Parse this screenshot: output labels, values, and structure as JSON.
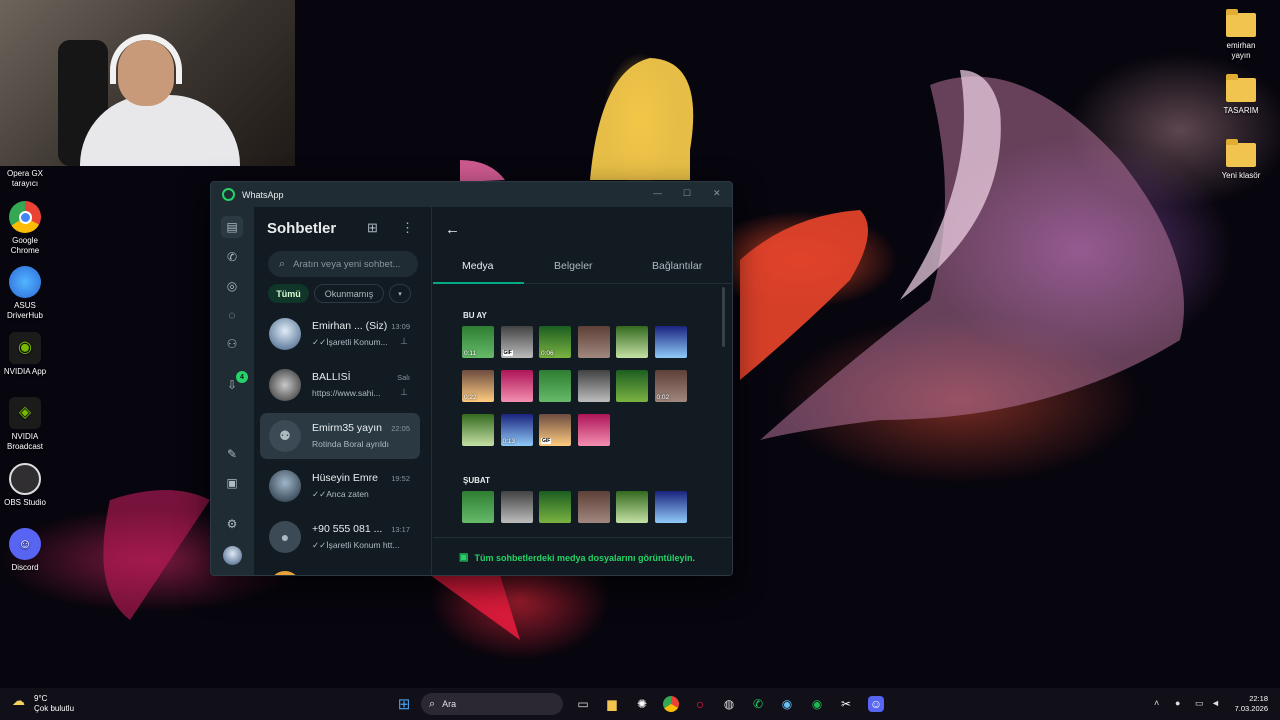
{
  "desktop": {
    "icons_left": [
      {
        "label": "Opera GX\ntarayıcı",
        "icon": "opera-gx-icon"
      },
      {
        "label": "Google\nChrome",
        "icon": "chrome-icon"
      },
      {
        "label": "ASUS\nDriverHub",
        "icon": "asus-driverhub-icon"
      },
      {
        "label": "NVIDIA App",
        "icon": "nvidia-app-icon"
      },
      {
        "label": "NVIDIA\nBroadcast",
        "icon": "nvidia-broadcast-icon"
      },
      {
        "label": "OBS Studio",
        "icon": "obs-icon"
      },
      {
        "label": "Discord",
        "icon": "discord-icon"
      }
    ],
    "icons_right": [
      {
        "label": "emirhan\nyayın",
        "icon": "folder-icon"
      },
      {
        "label": "TASARIM",
        "icon": "folder-icon"
      },
      {
        "label": "Yeni klasör",
        "icon": "folder-icon"
      }
    ]
  },
  "whatsapp": {
    "window_title": "WhatsApp",
    "rail": {
      "updates_badge": "4"
    },
    "list": {
      "title": "Sohbetler",
      "search_placeholder": "Aratın veya yeni sohbet...",
      "filters": [
        "Tümü",
        "Okunmamış"
      ],
      "chats": [
        {
          "name": "Emirhan ... (Siz)",
          "time": "13:09",
          "preview": "✓✓İşaretli Konum...",
          "pinned": true
        },
        {
          "name": "BALLISİ",
          "time": "Salı",
          "preview": "https://www.sahi...",
          "pinned": true
        },
        {
          "name": "Emirm35 yayın",
          "time": "22:05",
          "preview": "Rotinda Boral ayrıldı",
          "pinned": false
        },
        {
          "name": "Hüseyin Emre",
          "time": "19:52",
          "preview": "✓✓Anca zaten",
          "pinned": false
        },
        {
          "name": "+90 555 081 ...",
          "time": "13:17",
          "preview": "✓✓İşaretli Konum htt...",
          "pinned": false
        }
      ]
    },
    "panel": {
      "tabs": [
        "Medya",
        "Belgeler",
        "Bağlantılar"
      ],
      "active_tab": "Medya",
      "sections": [
        {
          "title": "BU AY",
          "rows": [
            [
              {
                "badge": "0:11"
              },
              {
                "badge": "GIF"
              },
              {
                "badge": "0:06"
              },
              {
                "badge": ""
              },
              {
                "badge": ""
              },
              {
                "badge": ""
              }
            ],
            [
              {
                "badge": "0:22"
              },
              {
                "badge": ""
              },
              {
                "badge": ""
              },
              {
                "badge": ""
              },
              {
                "badge": ""
              },
              {
                "badge": "0:02"
              }
            ],
            [
              {
                "badge": ""
              },
              {
                "badge": "0:13"
              },
              {
                "badge": "GIF"
              },
              {
                "badge": ""
              }
            ]
          ]
        },
        {
          "title": "ŞUBAT",
          "rows": [
            [
              {
                "badge": ""
              },
              {
                "badge": ""
              },
              {
                "badge": ""
              },
              {
                "badge": ""
              },
              {
                "badge": ""
              },
              {
                "badge": ""
              }
            ]
          ]
        }
      ],
      "footer_link": "Tüm sohbetlerdeki medya dosyalarını görüntüleyin."
    }
  },
  "taskbar": {
    "weather_temp": "9°C",
    "weather_desc": "Çok bulutlu",
    "search_placeholder": "Ara",
    "time": "22:18",
    "date": "7.03.2026"
  },
  "colors": {
    "accent": "#00a884",
    "accent_text": "#25d366",
    "panel_bg": "#111b21",
    "rail_bg": "#202c33"
  }
}
